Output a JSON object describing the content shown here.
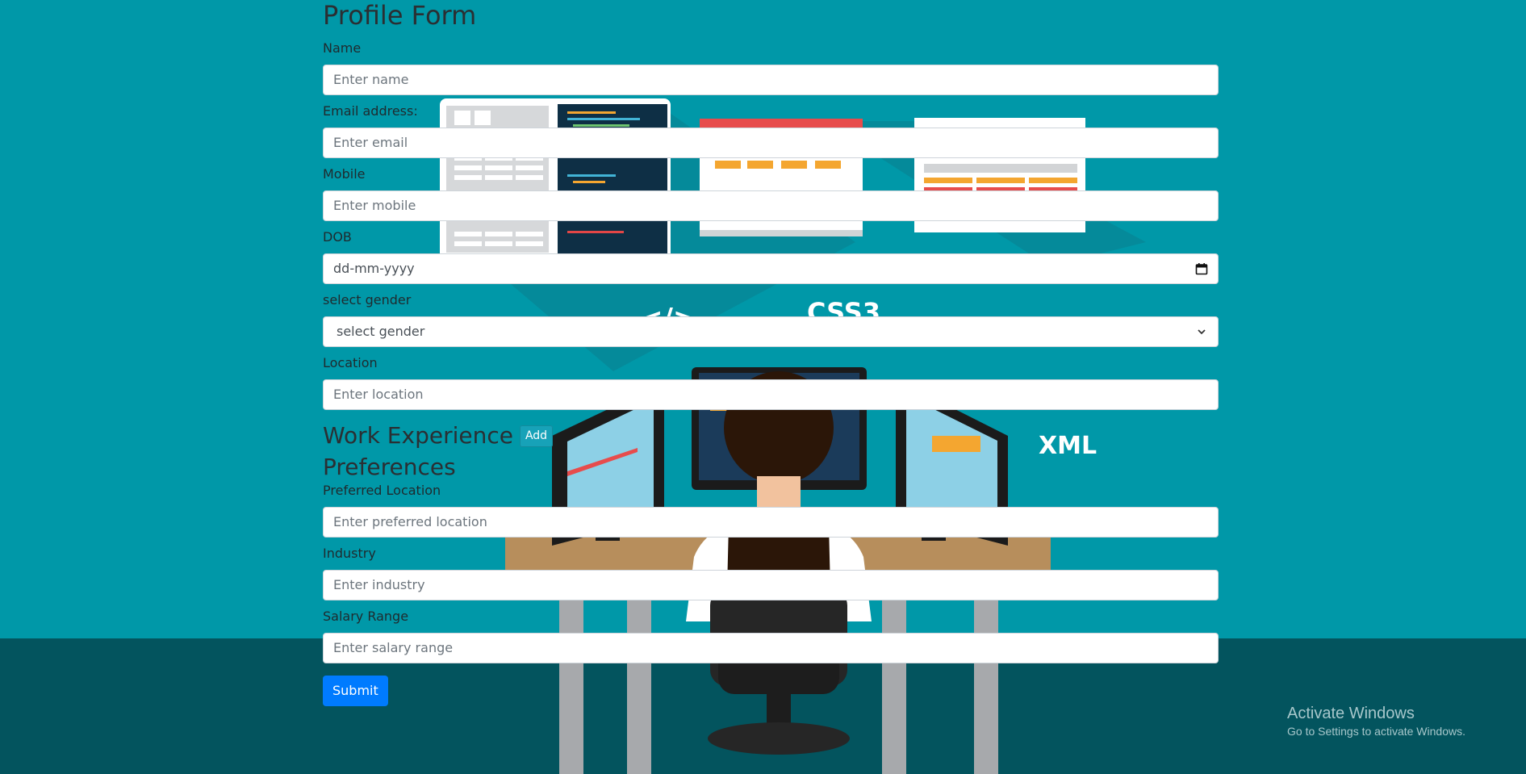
{
  "form": {
    "title": "Profile Form",
    "fields": [
      {
        "label": "Name",
        "placeholder": "Enter name"
      },
      {
        "label": "Email address:",
        "placeholder": "Enter email"
      },
      {
        "label": "Mobile",
        "placeholder": "Enter mobile"
      },
      {
        "label": "DOB",
        "placeholder": "dd-mm-yyyy"
      },
      {
        "label": "select gender",
        "value": "select gender"
      },
      {
        "label": "Location",
        "placeholder": "Enter location"
      }
    ],
    "work_experience": {
      "title": "Work Experience",
      "add_label": "Add"
    },
    "preferences": {
      "title": "Preferences",
      "fields": [
        {
          "label": "Preferred Location",
          "placeholder": "Enter preferred location"
        },
        {
          "label": "Industry",
          "placeholder": "Enter industry"
        },
        {
          "label": "Salary Range",
          "placeholder": "Enter salary range"
        }
      ]
    },
    "submit_label": "Submit"
  },
  "background": {
    "labels": [
      "</>",
      "CSS3",
      "XML"
    ]
  },
  "watermark": {
    "title": "Activate Windows",
    "subtitle": "Go to Settings to activate Windows."
  },
  "colors": {
    "background": "#0098a8",
    "floor": "#03545e",
    "add_button": "#17a2b8",
    "submit_button": "#007bff"
  }
}
